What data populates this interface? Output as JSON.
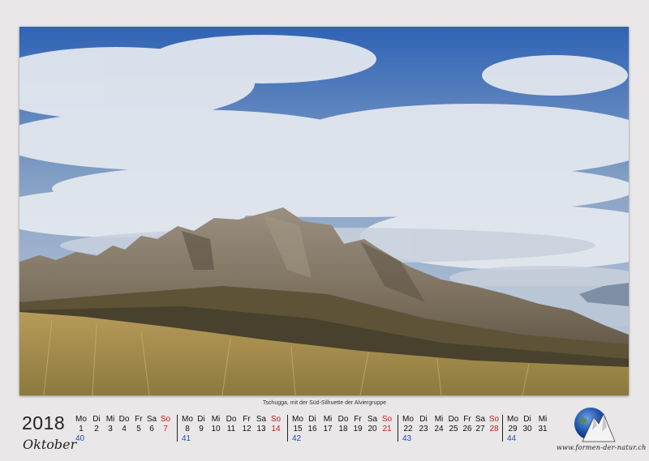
{
  "photo": {
    "caption": "Tschugga, mit der Süd-Silhuette der Alviergruppe"
  },
  "calendar": {
    "year": "2018",
    "month": "Oktober",
    "weeks": [
      {
        "week": "40",
        "days": [
          {
            "name": "Mo",
            "date": "1"
          },
          {
            "name": "Di",
            "date": "2"
          },
          {
            "name": "Mi",
            "date": "3"
          },
          {
            "name": "Do",
            "date": "4"
          },
          {
            "name": "Fr",
            "date": "5"
          },
          {
            "name": "Sa",
            "date": "6"
          },
          {
            "name": "So",
            "date": "7"
          }
        ]
      },
      {
        "week": "41",
        "days": [
          {
            "name": "Mo",
            "date": "8"
          },
          {
            "name": "Di",
            "date": "9"
          },
          {
            "name": "Mi",
            "date": "10"
          },
          {
            "name": "Do",
            "date": "11"
          },
          {
            "name": "Fr",
            "date": "12"
          },
          {
            "name": "Sa",
            "date": "13"
          },
          {
            "name": "So",
            "date": "14"
          }
        ]
      },
      {
        "week": "42",
        "days": [
          {
            "name": "Mo",
            "date": "15"
          },
          {
            "name": "Di",
            "date": "16"
          },
          {
            "name": "Mi",
            "date": "17"
          },
          {
            "name": "Do",
            "date": "18"
          },
          {
            "name": "Fr",
            "date": "19"
          },
          {
            "name": "Sa",
            "date": "20"
          },
          {
            "name": "So",
            "date": "21"
          }
        ]
      },
      {
        "week": "43",
        "days": [
          {
            "name": "Mo",
            "date": "22"
          },
          {
            "name": "Di",
            "date": "23"
          },
          {
            "name": "Mi",
            "date": "24"
          },
          {
            "name": "Do",
            "date": "25"
          },
          {
            "name": "Fr",
            "date": "26"
          },
          {
            "name": "Sa",
            "date": "27"
          },
          {
            "name": "So",
            "date": "28"
          }
        ]
      },
      {
        "week": "44",
        "days": [
          {
            "name": "Mo",
            "date": "29"
          },
          {
            "name": "Di",
            "date": "30"
          },
          {
            "name": "Mi",
            "date": "31"
          }
        ]
      }
    ]
  },
  "brand": {
    "url": "www.formen-der-natur.ch"
  },
  "colors": {
    "sunday": "#d01818",
    "week_number": "#1f4fb4"
  }
}
